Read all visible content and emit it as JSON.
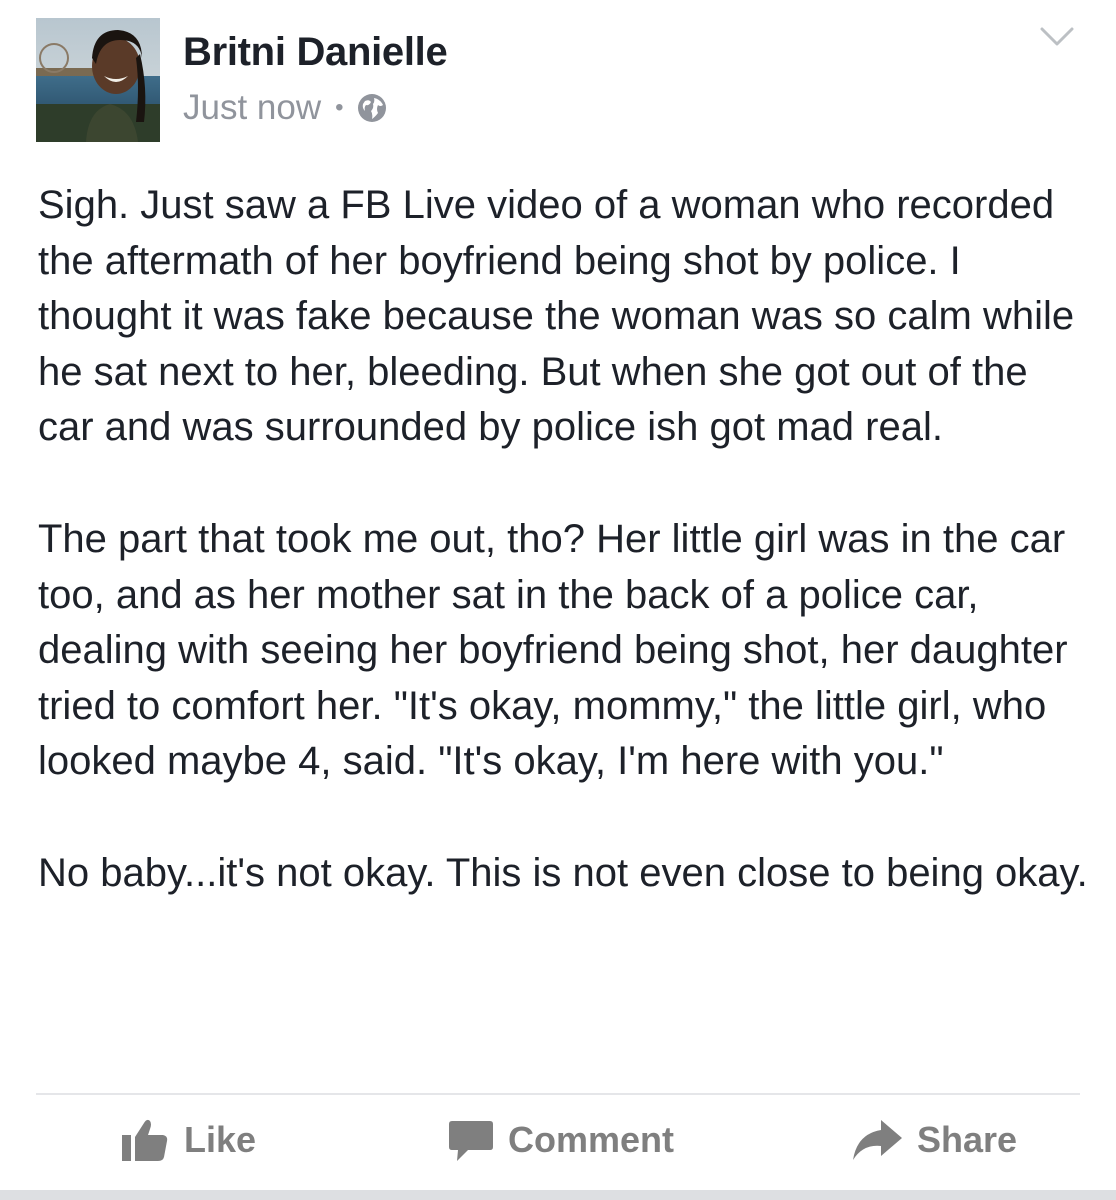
{
  "post": {
    "author": "Britni Danielle",
    "timestamp": "Just now",
    "separator": "•",
    "privacy_icon": "globe-icon",
    "menu_icon": "chevron-down-icon",
    "paragraphs": [
      "Sigh. Just saw a FB Live video of a woman who recorded the aftermath of her boyfriend being shot by police. I thought it was fake because the woman was so calm while he sat next to her, bleeding. But when she got out of the car and was surrounded by police ish got mad real.",
      "The part that took me out, tho? Her little girl was in the car too, and as her mother sat in the back of a police car, dealing with seeing her boyfriend being shot, her daughter tried to comfort her. \"It's okay, mommy,\" the little girl, who looked maybe 4, said. \"It's okay, I'm here with you.\"",
      "No baby...it's not okay. This is not even close to being okay."
    ]
  },
  "actions": {
    "like": "Like",
    "comment": "Comment",
    "share": "Share"
  },
  "colors": {
    "text": "#1d2129",
    "meta": "#90949c",
    "action": "#7f7f7f",
    "divider": "#e5e6e9"
  }
}
